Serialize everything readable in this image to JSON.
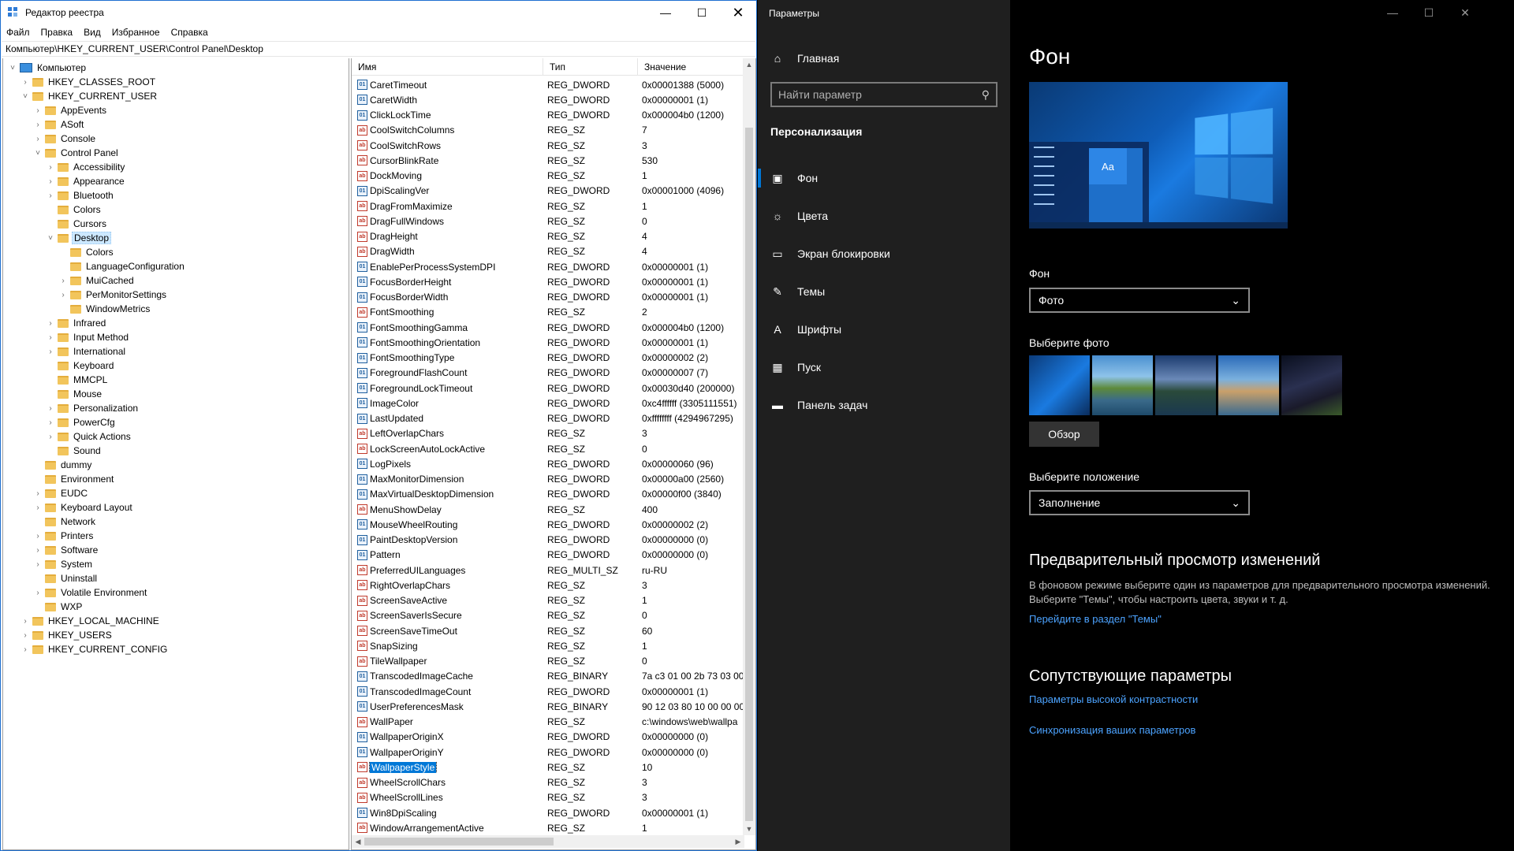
{
  "regedit": {
    "title": "Редактор реестра",
    "menu": [
      "Файл",
      "Правка",
      "Вид",
      "Избранное",
      "Справка"
    ],
    "address": "Компьютер\\HKEY_CURRENT_USER\\Control Panel\\Desktop",
    "tree": [
      {
        "label": "Компьютер",
        "level": 0,
        "exp": "v",
        "icon": "computer-icon"
      },
      {
        "label": "HKEY_CLASSES_ROOT",
        "level": 1,
        "exp": ">"
      },
      {
        "label": "HKEY_CURRENT_USER",
        "level": 1,
        "exp": "v"
      },
      {
        "label": "AppEvents",
        "level": 2,
        "exp": ">"
      },
      {
        "label": "ASoft",
        "level": 2,
        "exp": ">"
      },
      {
        "label": "Console",
        "level": 2,
        "exp": ">"
      },
      {
        "label": "Control Panel",
        "level": 2,
        "exp": "v"
      },
      {
        "label": "Accessibility",
        "level": 3,
        "exp": ">"
      },
      {
        "label": "Appearance",
        "level": 3,
        "exp": ">"
      },
      {
        "label": "Bluetooth",
        "level": 3,
        "exp": ">"
      },
      {
        "label": "Colors",
        "level": 3,
        "exp": ""
      },
      {
        "label": "Cursors",
        "level": 3,
        "exp": ""
      },
      {
        "label": "Desktop",
        "level": 3,
        "exp": "v",
        "selected": true
      },
      {
        "label": "Colors",
        "level": 4,
        "exp": ""
      },
      {
        "label": "LanguageConfiguration",
        "level": 4,
        "exp": ""
      },
      {
        "label": "MuiCached",
        "level": 4,
        "exp": ">"
      },
      {
        "label": "PerMonitorSettings",
        "level": 4,
        "exp": ">"
      },
      {
        "label": "WindowMetrics",
        "level": 4,
        "exp": ""
      },
      {
        "label": "Infrared",
        "level": 3,
        "exp": ">"
      },
      {
        "label": "Input Method",
        "level": 3,
        "exp": ">"
      },
      {
        "label": "International",
        "level": 3,
        "exp": ">"
      },
      {
        "label": "Keyboard",
        "level": 3,
        "exp": ""
      },
      {
        "label": "MMCPL",
        "level": 3,
        "exp": ""
      },
      {
        "label": "Mouse",
        "level": 3,
        "exp": ""
      },
      {
        "label": "Personalization",
        "level": 3,
        "exp": ">"
      },
      {
        "label": "PowerCfg",
        "level": 3,
        "exp": ">"
      },
      {
        "label": "Quick Actions",
        "level": 3,
        "exp": ">"
      },
      {
        "label": "Sound",
        "level": 3,
        "exp": ""
      },
      {
        "label": "dummy",
        "level": 2,
        "exp": ""
      },
      {
        "label": "Environment",
        "level": 2,
        "exp": ""
      },
      {
        "label": "EUDC",
        "level": 2,
        "exp": ">"
      },
      {
        "label": "Keyboard Layout",
        "level": 2,
        "exp": ">"
      },
      {
        "label": "Network",
        "level": 2,
        "exp": ""
      },
      {
        "label": "Printers",
        "level": 2,
        "exp": ">"
      },
      {
        "label": "Software",
        "level": 2,
        "exp": ">"
      },
      {
        "label": "System",
        "level": 2,
        "exp": ">"
      },
      {
        "label": "Uninstall",
        "level": 2,
        "exp": ""
      },
      {
        "label": "Volatile Environment",
        "level": 2,
        "exp": ">"
      },
      {
        "label": "WXP",
        "level": 2,
        "exp": ""
      },
      {
        "label": "HKEY_LOCAL_MACHINE",
        "level": 1,
        "exp": ">"
      },
      {
        "label": "HKEY_USERS",
        "level": 1,
        "exp": ">"
      },
      {
        "label": "HKEY_CURRENT_CONFIG",
        "level": 1,
        "exp": ">"
      }
    ],
    "columns": [
      "Имя",
      "Тип",
      "Значение"
    ],
    "values": [
      {
        "name": "CaretTimeout",
        "type": "REG_DWORD",
        "data": "0x00001388 (5000)"
      },
      {
        "name": "CaretWidth",
        "type": "REG_DWORD",
        "data": "0x00000001 (1)"
      },
      {
        "name": "ClickLockTime",
        "type": "REG_DWORD",
        "data": "0x000004b0 (1200)"
      },
      {
        "name": "CoolSwitchColumns",
        "type": "REG_SZ",
        "data": "7"
      },
      {
        "name": "CoolSwitchRows",
        "type": "REG_SZ",
        "data": "3"
      },
      {
        "name": "CursorBlinkRate",
        "type": "REG_SZ",
        "data": "530"
      },
      {
        "name": "DockMoving",
        "type": "REG_SZ",
        "data": "1"
      },
      {
        "name": "DpiScalingVer",
        "type": "REG_DWORD",
        "data": "0x00001000 (4096)"
      },
      {
        "name": "DragFromMaximize",
        "type": "REG_SZ",
        "data": "1"
      },
      {
        "name": "DragFullWindows",
        "type": "REG_SZ",
        "data": "0"
      },
      {
        "name": "DragHeight",
        "type": "REG_SZ",
        "data": "4"
      },
      {
        "name": "DragWidth",
        "type": "REG_SZ",
        "data": "4"
      },
      {
        "name": "EnablePerProcessSystemDPI",
        "type": "REG_DWORD",
        "data": "0x00000001 (1)"
      },
      {
        "name": "FocusBorderHeight",
        "type": "REG_DWORD",
        "data": "0x00000001 (1)"
      },
      {
        "name": "FocusBorderWidth",
        "type": "REG_DWORD",
        "data": "0x00000001 (1)"
      },
      {
        "name": "FontSmoothing",
        "type": "REG_SZ",
        "data": "2"
      },
      {
        "name": "FontSmoothingGamma",
        "type": "REG_DWORD",
        "data": "0x000004b0 (1200)"
      },
      {
        "name": "FontSmoothingOrientation",
        "type": "REG_DWORD",
        "data": "0x00000001 (1)"
      },
      {
        "name": "FontSmoothingType",
        "type": "REG_DWORD",
        "data": "0x00000002 (2)"
      },
      {
        "name": "ForegroundFlashCount",
        "type": "REG_DWORD",
        "data": "0x00000007 (7)"
      },
      {
        "name": "ForegroundLockTimeout",
        "type": "REG_DWORD",
        "data": "0x00030d40 (200000)"
      },
      {
        "name": "ImageColor",
        "type": "REG_DWORD",
        "data": "0xc4ffffff (3305111551)"
      },
      {
        "name": "LastUpdated",
        "type": "REG_DWORD",
        "data": "0xffffffff (4294967295)"
      },
      {
        "name": "LeftOverlapChars",
        "type": "REG_SZ",
        "data": "3"
      },
      {
        "name": "LockScreenAutoLockActive",
        "type": "REG_SZ",
        "data": "0"
      },
      {
        "name": "LogPixels",
        "type": "REG_DWORD",
        "data": "0x00000060 (96)"
      },
      {
        "name": "MaxMonitorDimension",
        "type": "REG_DWORD",
        "data": "0x00000a00 (2560)"
      },
      {
        "name": "MaxVirtualDesktopDimension",
        "type": "REG_DWORD",
        "data": "0x00000f00 (3840)"
      },
      {
        "name": "MenuShowDelay",
        "type": "REG_SZ",
        "data": "400"
      },
      {
        "name": "MouseWheelRouting",
        "type": "REG_DWORD",
        "data": "0x00000002 (2)"
      },
      {
        "name": "PaintDesktopVersion",
        "type": "REG_DWORD",
        "data": "0x00000000 (0)"
      },
      {
        "name": "Pattern",
        "type": "REG_DWORD",
        "data": "0x00000000 (0)"
      },
      {
        "name": "PreferredUILanguages",
        "type": "REG_MULTI_SZ",
        "data": "ru-RU"
      },
      {
        "name": "RightOverlapChars",
        "type": "REG_SZ",
        "data": "3"
      },
      {
        "name": "ScreenSaveActive",
        "type": "REG_SZ",
        "data": "1"
      },
      {
        "name": "ScreenSaverIsSecure",
        "type": "REG_SZ",
        "data": "0"
      },
      {
        "name": "ScreenSaveTimeOut",
        "type": "REG_SZ",
        "data": "60"
      },
      {
        "name": "SnapSizing",
        "type": "REG_SZ",
        "data": "1"
      },
      {
        "name": "TileWallpaper",
        "type": "REG_SZ",
        "data": "0"
      },
      {
        "name": "TranscodedImageCache",
        "type": "REG_BINARY",
        "data": "7a c3 01 00 2b 73 03 00 8"
      },
      {
        "name": "TranscodedImageCount",
        "type": "REG_DWORD",
        "data": "0x00000001 (1)"
      },
      {
        "name": "UserPreferencesMask",
        "type": "REG_BINARY",
        "data": "90 12 03 80 10 00 00 00"
      },
      {
        "name": "WallPaper",
        "type": "REG_SZ",
        "data": "c:\\windows\\web\\wallpa"
      },
      {
        "name": "WallpaperOriginX",
        "type": "REG_DWORD",
        "data": "0x00000000 (0)"
      },
      {
        "name": "WallpaperOriginY",
        "type": "REG_DWORD",
        "data": "0x00000000 (0)"
      },
      {
        "name": "WallpaperStyle",
        "type": "REG_SZ",
        "data": "10",
        "selected": true
      },
      {
        "name": "WheelScrollChars",
        "type": "REG_SZ",
        "data": "3"
      },
      {
        "name": "WheelScrollLines",
        "type": "REG_SZ",
        "data": "3"
      },
      {
        "name": "Win8DpiScaling",
        "type": "REG_DWORD",
        "data": "0x00000001 (1)"
      },
      {
        "name": "WindowArrangementActive",
        "type": "REG_SZ",
        "data": "1"
      }
    ]
  },
  "settings": {
    "title": "Параметры",
    "home": "Главная",
    "search_placeholder": "Найти параметр",
    "section": "Персонализация",
    "nav": [
      {
        "label": "Фон",
        "icon": "image-icon",
        "active": true
      },
      {
        "label": "Цвета",
        "icon": "palette-icon"
      },
      {
        "label": "Экран блокировки",
        "icon": "lockscreen-icon"
      },
      {
        "label": "Темы",
        "icon": "brush-icon"
      },
      {
        "label": "Шрифты",
        "icon": "font-icon"
      },
      {
        "label": "Пуск",
        "icon": "start-icon"
      },
      {
        "label": "Панель задач",
        "icon": "taskbar-icon"
      }
    ],
    "page_title": "Фон",
    "preview_tile": "Aa",
    "background_label": "Фон",
    "background_value": "Фото",
    "choose_photo_label": "Выберите фото",
    "browse_button": "Обзор",
    "position_label": "Выберите положение",
    "position_value": "Заполнение",
    "preview_heading": "Предварительный просмотр изменений",
    "preview_desc": "В фоновом режиме выберите один из параметров для предварительного просмотра изменений. Выберите \"Темы\", чтобы настроить цвета, звуки и т. д.",
    "themes_link": "Перейдите в раздел \"Темы\"",
    "related_heading": "Сопутствующие параметры",
    "related_links": [
      "Параметры высокой контрастности",
      "Синхронизация ваших параметров"
    ]
  }
}
